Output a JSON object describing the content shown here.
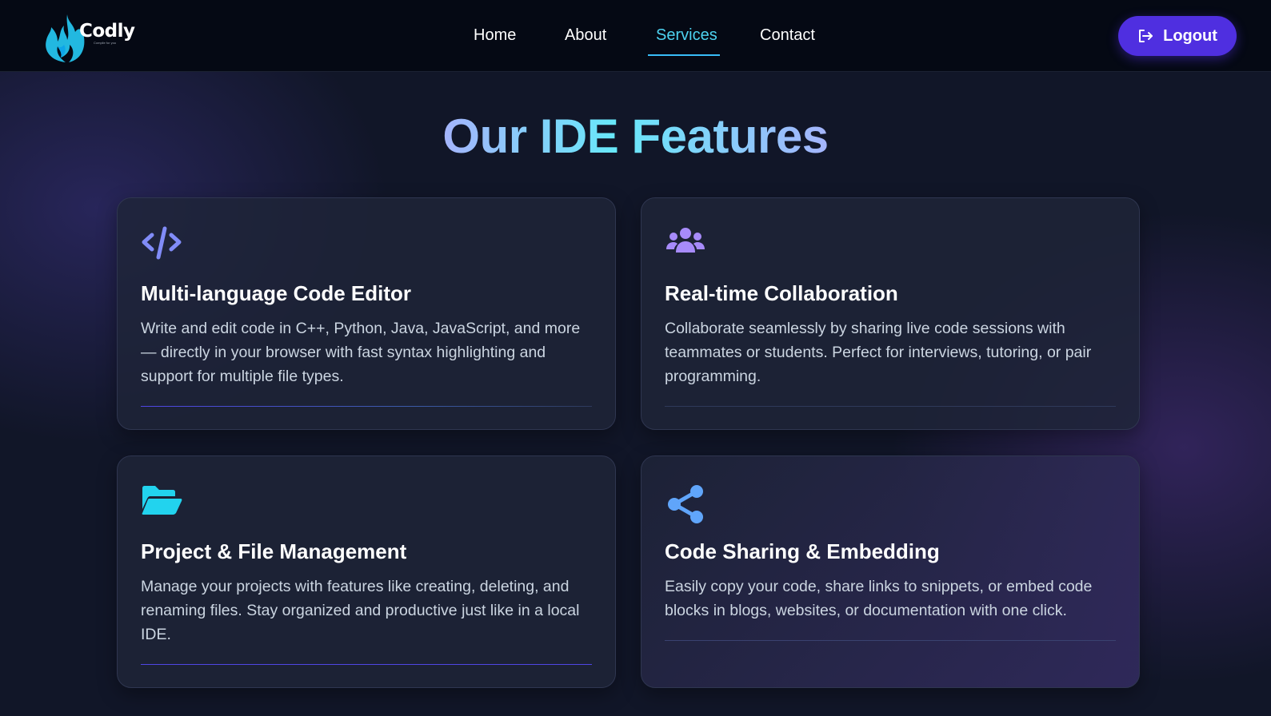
{
  "app": {
    "logo_text": "Codly",
    "logo_tagline": "Compile for you"
  },
  "nav": {
    "items": [
      {
        "label": "Home",
        "active": false
      },
      {
        "label": "About",
        "active": false
      },
      {
        "label": "Services",
        "active": true
      },
      {
        "label": "Contact",
        "active": false
      }
    ],
    "logout_label": "Logout",
    "logout_icon": "logout-icon"
  },
  "main": {
    "title": "Our IDE Features",
    "cards": [
      {
        "icon": "code-icon",
        "title": "Multi-language Code Editor",
        "description": "Write and edit code in C++, Python, Java, JavaScript, and more — directly in your browser with fast syntax highlighting and support for multiple file types."
      },
      {
        "icon": "users-icon",
        "title": "Real-time Collaboration",
        "description": "Collaborate seamlessly by sharing live code sessions with teammates or students. Perfect for interviews, tutoring, or pair programming."
      },
      {
        "icon": "folder-open-icon",
        "title": "Project & File Management",
        "description": "Manage your projects with features like creating, deleting, and renaming files. Stay organized and productive just like in a local IDE."
      },
      {
        "icon": "share-icon",
        "title": "Code Sharing & Embedding",
        "description": "Easily copy your code, share links to snippets, or embed code blocks in blogs, websites, or documentation with one click."
      }
    ]
  },
  "colors": {
    "accent": "#4f2fe0",
    "active_nav": "#4dd2f0",
    "background": "#111628"
  }
}
